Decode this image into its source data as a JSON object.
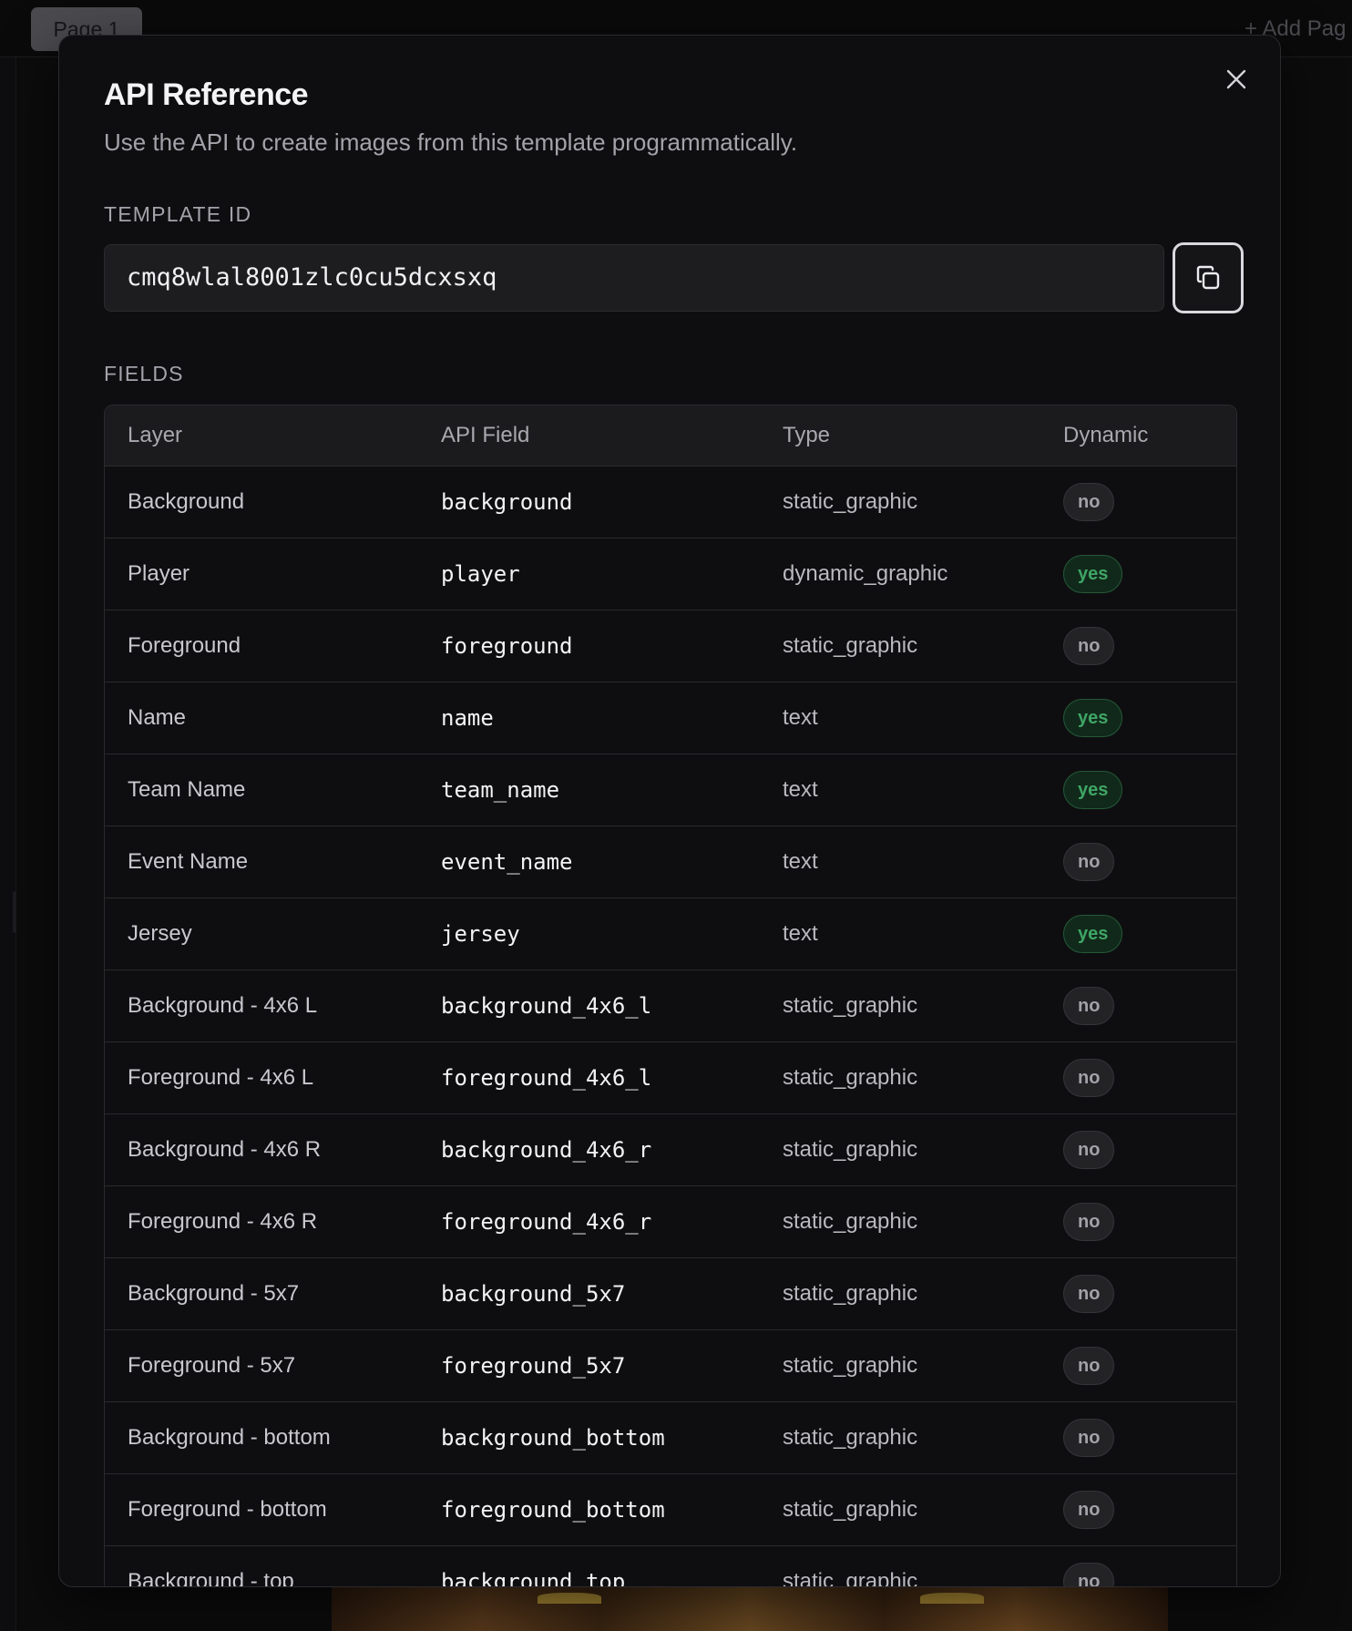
{
  "background_app": {
    "page_tab": "Page 1",
    "add_page": "+ Add Pag"
  },
  "modal": {
    "title": "API Reference",
    "subtitle": "Use the API to create images from this template programmatically.",
    "close_icon": "close-icon",
    "template_id_label": "TEMPLATE ID",
    "template_id": "cmq8wlal8001zlc0cu5dcxsxq",
    "copy_icon": "copy-icon",
    "fields_label": "FIELDS",
    "columns": {
      "layer": "Layer",
      "api_field": "API Field",
      "type": "Type",
      "dynamic": "Dynamic"
    },
    "rows": [
      {
        "layer": "Background",
        "api_field": "background",
        "type": "static_graphic",
        "dynamic": "no"
      },
      {
        "layer": "Player",
        "api_field": "player",
        "type": "dynamic_graphic",
        "dynamic": "yes"
      },
      {
        "layer": "Foreground",
        "api_field": "foreground",
        "type": "static_graphic",
        "dynamic": "no"
      },
      {
        "layer": "Name",
        "api_field": "name",
        "type": "text",
        "dynamic": "yes"
      },
      {
        "layer": "Team Name",
        "api_field": "team_name",
        "type": "text",
        "dynamic": "yes"
      },
      {
        "layer": "Event Name",
        "api_field": "event_name",
        "type": "text",
        "dynamic": "no"
      },
      {
        "layer": "Jersey",
        "api_field": "jersey",
        "type": "text",
        "dynamic": "yes"
      },
      {
        "layer": "Background - 4x6 L",
        "api_field": "background_4x6_l",
        "type": "static_graphic",
        "dynamic": "no"
      },
      {
        "layer": "Foreground - 4x6 L",
        "api_field": "foreground_4x6_l",
        "type": "static_graphic",
        "dynamic": "no"
      },
      {
        "layer": "Background - 4x6 R",
        "api_field": "background_4x6_r",
        "type": "static_graphic",
        "dynamic": "no"
      },
      {
        "layer": "Foreground - 4x6 R",
        "api_field": "foreground_4x6_r",
        "type": "static_graphic",
        "dynamic": "no"
      },
      {
        "layer": "Background - 5x7",
        "api_field": "background_5x7",
        "type": "static_graphic",
        "dynamic": "no"
      },
      {
        "layer": "Foreground - 5x7",
        "api_field": "foreground_5x7",
        "type": "static_graphic",
        "dynamic": "no"
      },
      {
        "layer": "Background - bottom",
        "api_field": "background_bottom",
        "type": "static_graphic",
        "dynamic": "no"
      },
      {
        "layer": "Foreground - bottom",
        "api_field": "foreground_bottom",
        "type": "static_graphic",
        "dynamic": "no"
      },
      {
        "layer": "Background - top",
        "api_field": "background_top",
        "type": "static_graphic",
        "dynamic": "no"
      }
    ]
  },
  "colors": {
    "badge_yes": "#3fa565",
    "badge_no": "#a1a1a7",
    "modal_bg": "#0e0e10"
  }
}
